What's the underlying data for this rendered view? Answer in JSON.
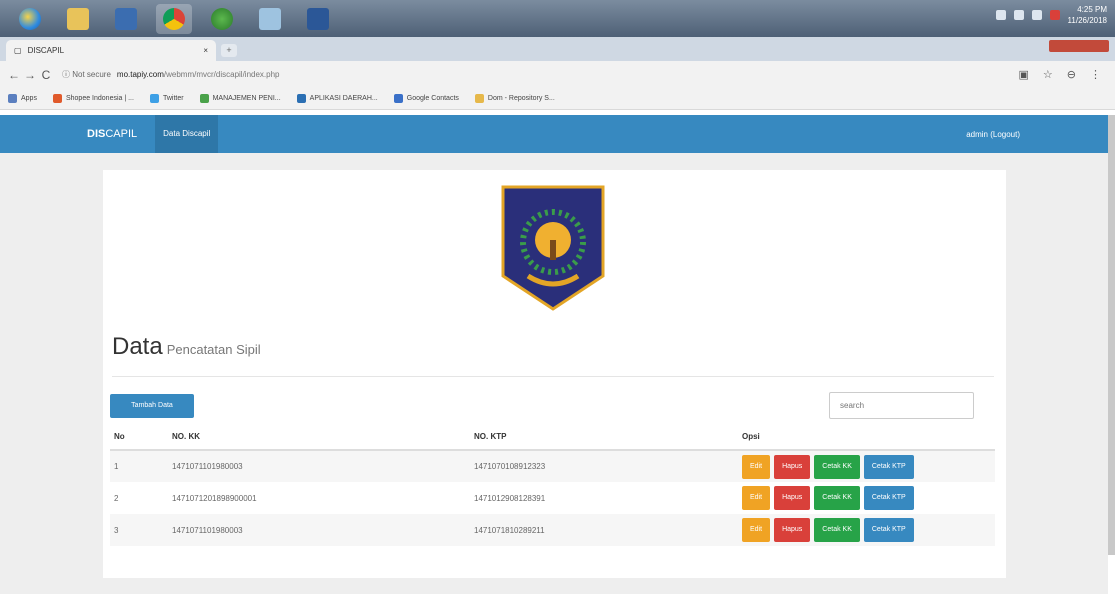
{
  "taskbar": {
    "icons": [
      "windows-start-icon",
      "file-explorer-icon",
      "media-icon",
      "chrome-icon",
      "app-icon",
      "app-icon-2",
      "word-icon"
    ],
    "time": "4:25 PM",
    "date": "11/26/2018"
  },
  "browser": {
    "tab_title": "DISCAPIL",
    "tab_close": "×",
    "new_tab": "+",
    "back": "←",
    "forward": "→",
    "reload": "C",
    "security": "ⓘ  Not secure",
    "url_host": "mo.tapiy.com",
    "url_path": "/webmm/mvcr/discapil/index.php",
    "bookmarks": [
      "Apps",
      "Shopee Indonesia | ...",
      "Twitter",
      "MANAJEMEN PENI...",
      "APLIKASI DAERAH...",
      "Google Contacts",
      "Dom - Repository S..."
    ],
    "bookmark_colors": [
      "#5b7fbf",
      "#e05a2b",
      "#3ea0e6",
      "#4aa24a",
      "#2b6fb3",
      "#3a70c8",
      "#e6b84a"
    ]
  },
  "navbar": {
    "brand_bold": "DIS",
    "brand_rest": "CAPIL",
    "link": "Data Discapil",
    "user": "admin (Logout)"
  },
  "content": {
    "title": "Data",
    "subtitle": "Pencatatan Sipil",
    "add_button": "Tambah Data",
    "search_placeholder": "search"
  },
  "table": {
    "headers": [
      "No",
      "NO. KK",
      "NO. KTP",
      "Opsi"
    ],
    "rows": [
      {
        "no": "1",
        "kk": "1471071101980003",
        "ktp": "1471070108912323"
      },
      {
        "no": "2",
        "kk": "1471071201898900001",
        "ktp": "1471012908128391"
      },
      {
        "no": "3",
        "kk": "1471071101980003",
        "ktp": "1471071810289211"
      }
    ],
    "actions": {
      "edit": "Edit",
      "delete": "Hapus",
      "print_kk": "Cetak KK",
      "print_ktp": "Cetak KTP"
    }
  },
  "colors": {
    "navbar": "#3789c0",
    "edit": "#f0a324",
    "delete": "#d9403a",
    "print_kk": "#27a348",
    "print_ktp": "#3789c0"
  }
}
